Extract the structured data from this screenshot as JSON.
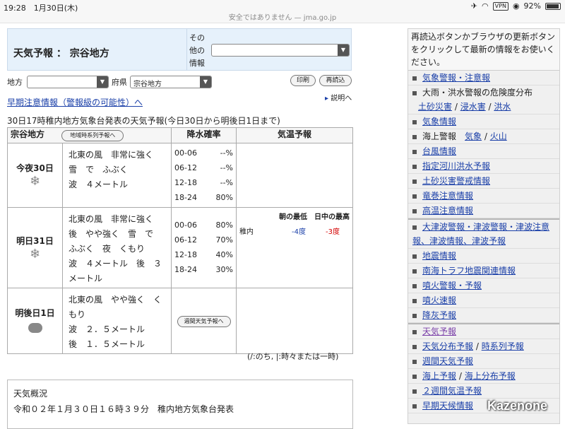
{
  "status": {
    "time": "19:28",
    "date": "1月30日(木)",
    "url": "安全ではありません — jma.go.jp",
    "battery": "92%",
    "vpn": "VPN"
  },
  "header": {
    "title": "天気予報 ： 宗谷地方",
    "other_label": "その他の情報"
  },
  "filter": {
    "region_label": "地方",
    "pref_label": "府県",
    "pref_value": "宗谷地方",
    "print": "印刷",
    "reload": "再読込"
  },
  "early_warning": "早期注意情報（警報級の可能性）へ",
  "explain": "説明へ",
  "issued": "30日17時稚内地方気象台発表の天気予報(今日30日から明後日1日まで)",
  "table": {
    "area": "宗谷地方",
    "series_btn": "地域時系列予報へ",
    "col_pop": "降水確率",
    "col_temp": "気温予報",
    "days": [
      {
        "label": "今夜30日",
        "weather": [
          "北東の風　非常に強く",
          "雪　で　ふぶく",
          "波　４メートル"
        ],
        "pop": [
          [
            "00-06",
            "--%"
          ],
          [
            "06-12",
            "--%"
          ],
          [
            "12-18",
            "--%"
          ],
          [
            "18-24",
            "80%"
          ]
        ]
      },
      {
        "label": "明日31日",
        "weather": [
          "北東の風　非常に強く",
          "後　やや強く　雪　で",
          "ふぶく　夜　くもり",
          "波　４メートル　後　３",
          "メートル"
        ],
        "pop": [
          [
            "00-06",
            "80%"
          ],
          [
            "06-12",
            "70%"
          ],
          [
            "12-18",
            "40%"
          ],
          [
            "18-24",
            "30%"
          ]
        ],
        "temp": {
          "min_label": "朝の最低",
          "max_label": "日中の最高",
          "city": "稚内",
          "min": "-4度",
          "max": "-3度"
        }
      },
      {
        "label": "明後日1日",
        "weather": [
          "北東の風　やや強く　く",
          "もり",
          "波　２．５メートル",
          "後　１．５メートル"
        ],
        "weekly_btn": "週間天気予報へ"
      }
    ],
    "footnote": "(/:のち, |:時々または一時)"
  },
  "summary": {
    "title": "天気概況",
    "line": "令和０２年１月３０日１６時３９分　稚内地方気象台発表"
  },
  "sidebar": {
    "notice": "再読込ボタンかブラウザの更新ボタンをクリックして最新の情報をお使いください。",
    "items": [
      {
        "label": "気象警報・注意報"
      },
      {
        "label": "大雨・洪水警報の危険度分布",
        "sub": [
          "土砂災害",
          "浸水害",
          "洪水"
        ]
      },
      {
        "label": "気象情報"
      },
      {
        "label": "海上警報",
        "sub": [
          "気象",
          "火山"
        ]
      },
      {
        "label": "台風情報"
      },
      {
        "label": "指定河川洪水予報"
      },
      {
        "label": "土砂災害警戒情報"
      },
      {
        "label": "竜巻注意情報"
      },
      {
        "label": "高温注意情報"
      },
      {
        "label": "大津波警報・津波警報・津波注意報、津波情報、津波予報"
      },
      {
        "label": "地震情報"
      },
      {
        "label": "南海トラフ地震関連情報"
      },
      {
        "label": "噴火警報・予報"
      },
      {
        "label": "噴火速報"
      },
      {
        "label": "降灰予報"
      },
      {
        "label": "天気予報"
      },
      {
        "label": "天気分布予報",
        "extra": "時系列予報"
      },
      {
        "label": "週間天気予報"
      },
      {
        "label": "海上予報",
        "extra": "海上分布予報"
      },
      {
        "label": "２週間気温予報"
      },
      {
        "label": "早期天候情報"
      }
    ]
  },
  "watermark": "Kazenone"
}
